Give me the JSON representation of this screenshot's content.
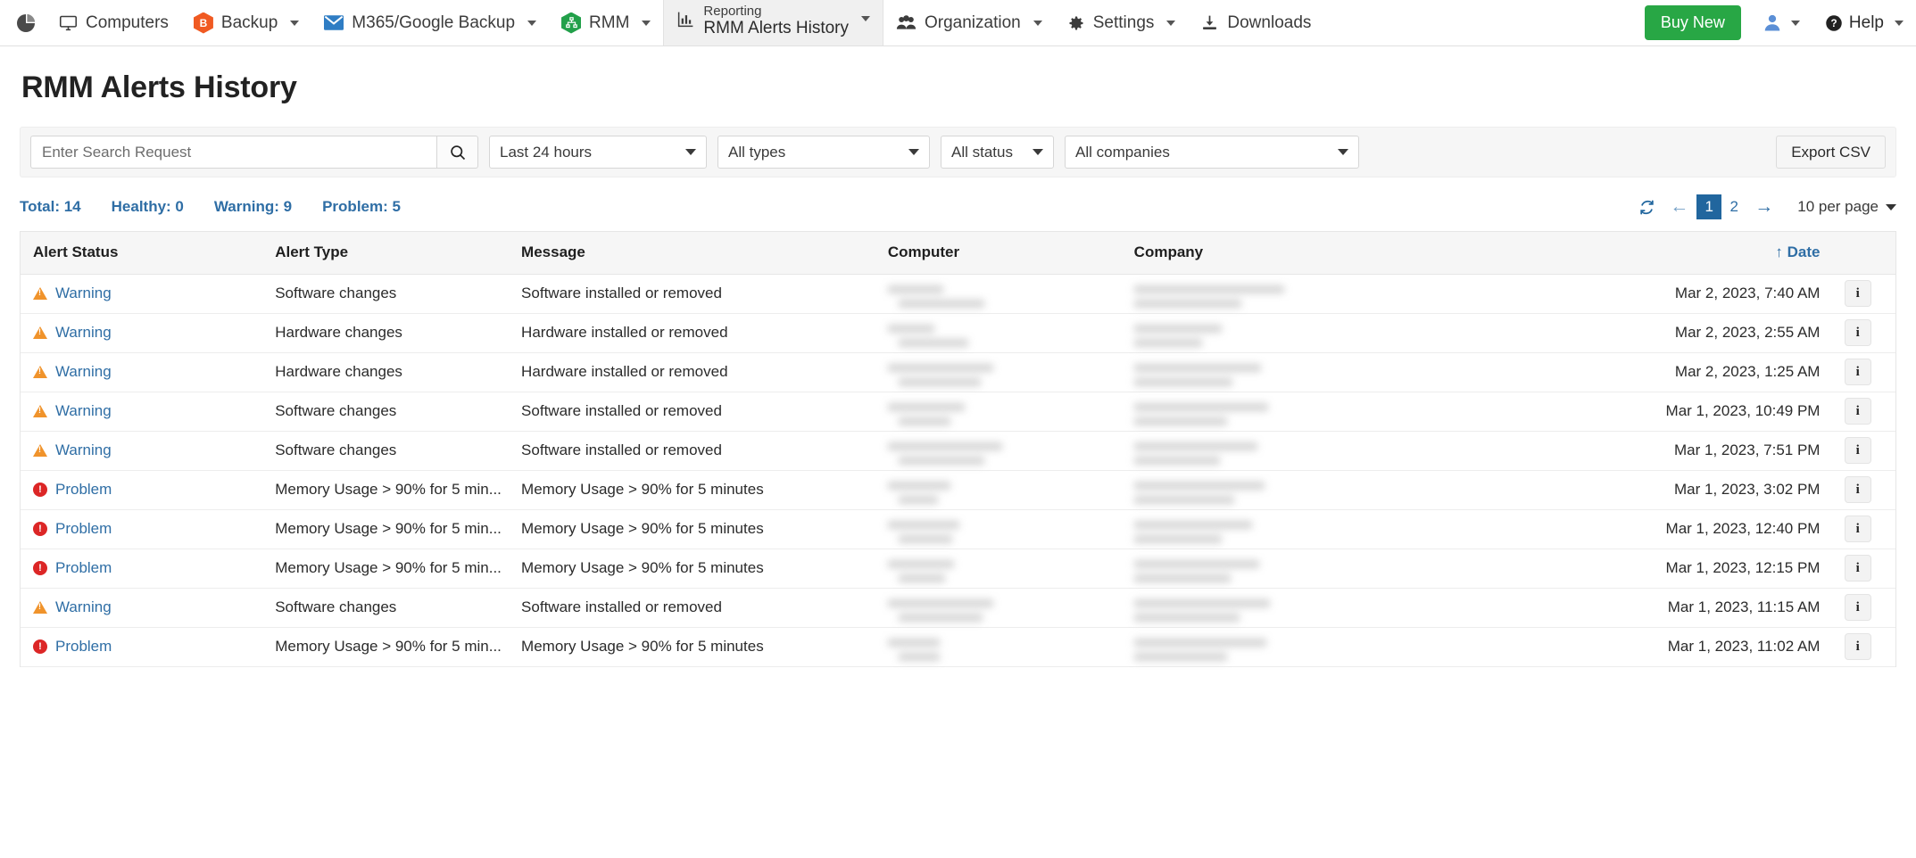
{
  "nav": {
    "logo_icon": "pie-chart-logo-icon",
    "items": [
      {
        "label": "Computers",
        "icon": "monitor-icon",
        "caret": false,
        "active": false,
        "icon_color": "#3c3c3c"
      },
      {
        "label": "Backup",
        "icon": "hex-b-icon",
        "caret": true,
        "active": false,
        "icon_color": "#f05a22",
        "icon_glyph": "B"
      },
      {
        "label": "M365/Google Backup",
        "icon": "envelope-icon",
        "caret": true,
        "active": false,
        "icon_color": "#2f7dc4"
      },
      {
        "label": "RMM",
        "icon": "hex-network-icon",
        "caret": true,
        "active": false,
        "icon_color": "#22a04a",
        "icon_glyph": "⑂"
      },
      {
        "label": "Reporting",
        "sublabel": "RMM Alerts History",
        "icon": "bar-chart-icon",
        "caret": true,
        "active": true,
        "icon_color": "#3c3c3c"
      },
      {
        "label": "Organization",
        "icon": "users-icon",
        "caret": true,
        "active": false,
        "icon_color": "#3c3c3c"
      },
      {
        "label": "Settings",
        "icon": "gear-icon",
        "caret": true,
        "active": false,
        "icon_color": "#3c3c3c"
      },
      {
        "label": "Downloads",
        "icon": "download-icon",
        "caret": false,
        "active": false,
        "icon_color": "#3c3c3c"
      }
    ],
    "buy_new_label": "Buy New",
    "buy_new_color": "#28a745",
    "account_icon": "user-avatar-icon",
    "help_label": "Help",
    "help_icon": "question-circle-icon"
  },
  "page": {
    "title": "RMM Alerts History"
  },
  "toolbar": {
    "search_placeholder": "Enter Search Request",
    "search_value": "",
    "search_icon": "search-icon",
    "period_filter": "Last 24 hours",
    "type_filter": "All types",
    "status_filter": "All status",
    "company_filter": "All companies",
    "export_label": "Export CSV"
  },
  "stats": [
    {
      "label": "Total: 14"
    },
    {
      "label": "Healthy: 0"
    },
    {
      "label": "Warning: 9"
    },
    {
      "label": "Problem: 5"
    }
  ],
  "pager": {
    "refresh_icon": "refresh-icon",
    "prev_icon": "arrow-left-icon",
    "next_icon": "arrow-right-icon",
    "pages": [
      "1",
      "2"
    ],
    "current_page": "1",
    "per_page_label": "10 per page",
    "accent_color": "#21669e"
  },
  "table": {
    "columns": [
      {
        "key": "status",
        "label": "Alert Status"
      },
      {
        "key": "type",
        "label": "Alert Type"
      },
      {
        "key": "message",
        "label": "Message"
      },
      {
        "key": "computer",
        "label": "Computer"
      },
      {
        "key": "company",
        "label": "Company"
      },
      {
        "key": "date",
        "label": "↑ Date",
        "sorted": true
      },
      {
        "key": "info",
        "label": ""
      }
    ],
    "rows": [
      {
        "status": "Warning",
        "severity": "warning",
        "type": "Software changes",
        "message": "Software installed or removed",
        "computer": "",
        "company": "",
        "date": "Mar 2, 2023, 7:40 AM",
        "info": "i"
      },
      {
        "status": "Warning",
        "severity": "warning",
        "type": "Hardware changes",
        "message": "Hardware installed or removed",
        "computer": "",
        "company": "",
        "date": "Mar 2, 2023, 2:55 AM",
        "info": "i"
      },
      {
        "status": "Warning",
        "severity": "warning",
        "type": "Hardware changes",
        "message": "Hardware installed or removed",
        "computer": "",
        "company": "",
        "date": "Mar 2, 2023, 1:25 AM",
        "info": "i"
      },
      {
        "status": "Warning",
        "severity": "warning",
        "type": "Software changes",
        "message": "Software installed or removed",
        "computer": "",
        "company": "",
        "date": "Mar 1, 2023, 10:49 PM",
        "info": "i"
      },
      {
        "status": "Warning",
        "severity": "warning",
        "type": "Software changes",
        "message": "Software installed or removed",
        "computer": "",
        "company": "",
        "date": "Mar 1, 2023, 7:51 PM",
        "info": "i"
      },
      {
        "status": "Problem",
        "severity": "problem",
        "type": "Memory Usage > 90% for 5 min...",
        "message": "Memory Usage > 90% for 5 minutes",
        "computer": "",
        "company": "",
        "date": "Mar 1, 2023, 3:02 PM",
        "info": "i"
      },
      {
        "status": "Problem",
        "severity": "problem",
        "type": "Memory Usage > 90% for 5 min...",
        "message": "Memory Usage > 90% for 5 minutes",
        "computer": "",
        "company": "",
        "date": "Mar 1, 2023, 12:40 PM",
        "info": "i"
      },
      {
        "status": "Problem",
        "severity": "problem",
        "type": "Memory Usage > 90% for 5 min...",
        "message": "Memory Usage > 90% for 5 minutes",
        "computer": "",
        "company": "",
        "date": "Mar 1, 2023, 12:15 PM",
        "info": "i"
      },
      {
        "status": "Warning",
        "severity": "warning",
        "type": "Software changes",
        "message": "Software installed or removed",
        "computer": "",
        "company": "",
        "date": "Mar 1, 2023, 11:15 AM",
        "info": "i"
      },
      {
        "status": "Problem",
        "severity": "problem",
        "type": "Memory Usage > 90% for 5 min...",
        "message": "Memory Usage > 90% for 5 minutes",
        "computer": "",
        "company": "",
        "date": "Mar 1, 2023, 11:02 AM",
        "info": "i"
      }
    ]
  },
  "colors": {
    "link": "#2f6ea5",
    "warning": "#f0932b",
    "problem": "#dc2626",
    "header_bg": "#f6f6f6"
  }
}
